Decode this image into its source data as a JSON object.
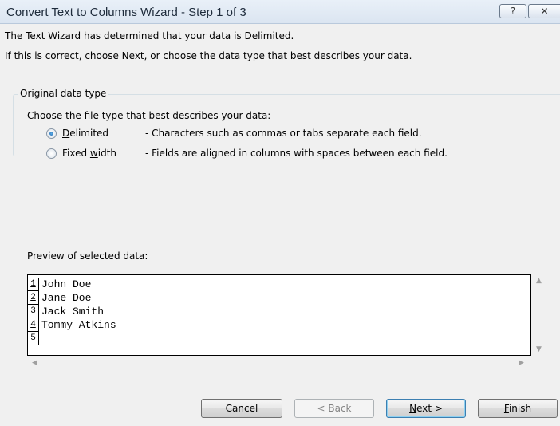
{
  "window": {
    "title": "Convert Text to Columns Wizard - Step 1 of 3",
    "help_icon": "?",
    "close_icon": "✕"
  },
  "intro": {
    "line1": "The Text Wizard has determined that your data is Delimited.",
    "line2": "If this is correct, choose Next, or choose the data type that best describes your data."
  },
  "data_type_group": {
    "legend": "Original data type",
    "prompt": "Choose the file type that best describes your data:",
    "options": [
      {
        "label_access": "D",
        "label_rest": "elimited",
        "description": "- Characters such as commas or tabs separate each field.",
        "checked": true
      },
      {
        "label_pre": "Fixed ",
        "label_access": "w",
        "label_rest": "idth",
        "description": "- Fields are aligned in columns with spaces between each field.",
        "checked": false
      }
    ]
  },
  "preview": {
    "label": "Preview of selected data:",
    "rows": [
      {
        "num": "1",
        "text": "John Doe"
      },
      {
        "num": "2",
        "text": "Jane Doe"
      },
      {
        "num": "3",
        "text": "Jack Smith"
      },
      {
        "num": "4",
        "text": "Tommy Atkins"
      },
      {
        "num": "5",
        "text": ""
      }
    ]
  },
  "buttons": {
    "cancel": "Cancel",
    "back": "< Back",
    "next_access": "N",
    "next_rest": "ext >",
    "finish_access": "F",
    "finish_rest": "inish"
  }
}
